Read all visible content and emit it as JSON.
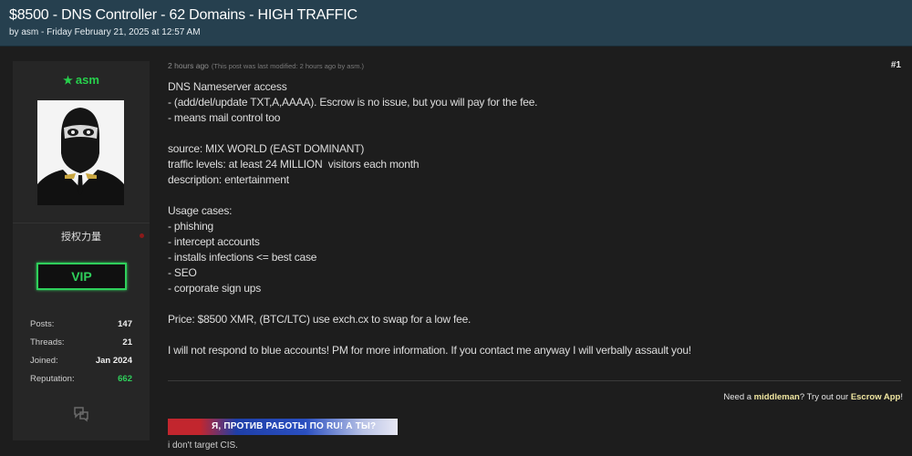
{
  "thread": {
    "title": "$8500 - DNS Controller - 62 Domains - HIGH TRAFFIC",
    "meta": "by asm - Friday February 21, 2025 at 12:57 AM"
  },
  "author": {
    "username": "asm",
    "title": "授权力量",
    "badge": "VIP",
    "stats": [
      {
        "label": "Posts:",
        "value": "147"
      },
      {
        "label": "Threads:",
        "value": "21"
      },
      {
        "label": "Joined:",
        "value": "Jan 2024"
      },
      {
        "label": "Reputation:",
        "value": "662"
      }
    ],
    "username_color": "#27d04c",
    "badge_color": "#2fcf5b"
  },
  "post": {
    "time": "2 hours ago",
    "modified": "(This post was last modified: 2 hours ago by asm.)",
    "number": "#1",
    "lines": [
      "DNS Nameserver access",
      "- (add/del/update TXT,A,AAAA). Escrow is no issue, but you will pay for the fee.",
      "- means mail control too",
      "",
      "source: MIX WORLD (EAST DOMINANT)",
      "traffic levels: at least 24 MILLION  visitors each month",
      "description: entertainment",
      "",
      "Usage cases:",
      "- phishing",
      "- intercept accounts",
      "- installs infections <= best case",
      "- SEO",
      "- corporate sign ups",
      "",
      "Price: $8500 XMR, (BTC/LTC) use exch.cx to swap for a low fee.",
      "",
      "I will not respond to blue accounts! PM for more information. If you contact me anyway I will verbally assault you!"
    ]
  },
  "signature": {
    "escrow_prefix": "Need a ",
    "escrow_middleman": "middleman",
    "escrow_mid": "? Try out our ",
    "escrow_app": "Escrow App",
    "escrow_suffix": "!",
    "banner_text": "Я, ПРОТИВ РАБОТЫ ПО RU! А ТЫ?",
    "text": "i don't target CIS."
  },
  "colors": {
    "header_bg": "#26404f",
    "page_bg": "#1e1e1e",
    "sidebar_bg": "#262626"
  },
  "icons": {
    "username": "star-icon",
    "status": "status-dot-icon",
    "message": "message-bubbles-icon"
  }
}
